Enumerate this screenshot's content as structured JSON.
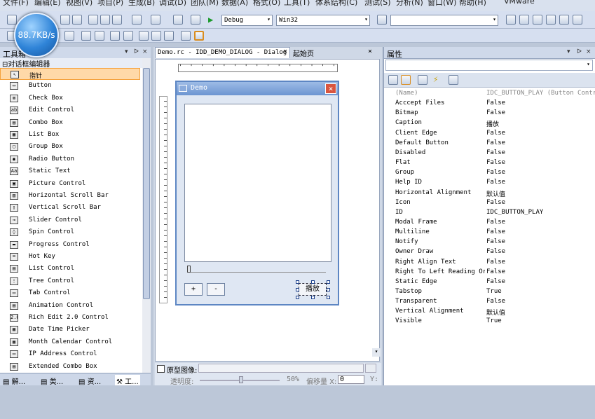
{
  "menu": [
    "文件(F)",
    "编辑(E)",
    "视图(V)",
    "项目(P)",
    "生成(B)",
    "调试(D)",
    "团队(M)",
    "数据(A)",
    "格式(O)",
    "工具(T)",
    "体系结构(C)",
    "测试(S)",
    "分析(N)",
    "窗口(W)",
    "帮助(H)",
    "VMware"
  ],
  "speed_overlay": "88.7KB/s",
  "toolbar": {
    "config": "Debug",
    "platform": "Win32",
    "search": ""
  },
  "toolbox": {
    "title": "工具箱",
    "category": "对话框编辑器",
    "items": [
      "指针",
      "Button",
      "Check Box",
      "Edit Control",
      "Combo Box",
      "List Box",
      "Group Box",
      "Radio Button",
      "Static Text",
      "Picture Control",
      "Horizontal Scroll Bar",
      "Vertical Scroll Bar",
      "Slider Control",
      "Spin Control",
      "Progress Control",
      "Hot Key",
      "List Control",
      "Tree Control",
      "Tab Control",
      "Animation Control",
      "Rich Edit 2.0 Control",
      "Date Time Picker",
      "Month Calendar Control",
      "IP Address Control",
      "Extended Combo Box"
    ],
    "selected": "指针"
  },
  "bottom_tabs": [
    "解...",
    "类...",
    "资...",
    "工..."
  ],
  "editor": {
    "tab_title": "Demo.rc - IDD_DEMO_DIALOG - Dialog",
    "tab_start": "起始页",
    "dialog_title": "Demo",
    "btn_plus": "+",
    "btn_minus": "-",
    "btn_play": "播放",
    "proto_label": "原型图像:",
    "opacity_label": "透明度:",
    "opacity_value": "50%",
    "offset_label": "偏移量 X:",
    "offset_x": "0",
    "offset_y_label": "Y:"
  },
  "properties": {
    "title": "属性",
    "rows": [
      {
        "name": "(Name)",
        "value": "IDC_BUTTON_PLAY (Button Control)",
        "faded": true
      },
      {
        "name": "Acccept Files",
        "value": "False"
      },
      {
        "name": "Bitmap",
        "value": "False"
      },
      {
        "name": "Caption",
        "value": "播放"
      },
      {
        "name": "Client Edge",
        "value": "False"
      },
      {
        "name": "Default Button",
        "value": "False"
      },
      {
        "name": "Disabled",
        "value": "False"
      },
      {
        "name": "Flat",
        "value": "False"
      },
      {
        "name": "Group",
        "value": "False"
      },
      {
        "name": "Help ID",
        "value": "False"
      },
      {
        "name": "Horizontal Alignment",
        "value": "默认值"
      },
      {
        "name": "Icon",
        "value": "False"
      },
      {
        "name": "ID",
        "value": "IDC_BUTTON_PLAY"
      },
      {
        "name": "Modal Frame",
        "value": "False"
      },
      {
        "name": "Multiline",
        "value": "False"
      },
      {
        "name": "Notify",
        "value": "False"
      },
      {
        "name": "Owner Draw",
        "value": "False"
      },
      {
        "name": "Right Align Text",
        "value": "False"
      },
      {
        "name": "Right To Left Reading Order",
        "value": "False"
      },
      {
        "name": "Static Edge",
        "value": "False"
      },
      {
        "name": "Tabstop",
        "value": "True"
      },
      {
        "name": "Transparent",
        "value": "False"
      },
      {
        "name": "Vertical Alignment",
        "value": "默认值"
      },
      {
        "name": "Visible",
        "value": "True"
      }
    ]
  }
}
